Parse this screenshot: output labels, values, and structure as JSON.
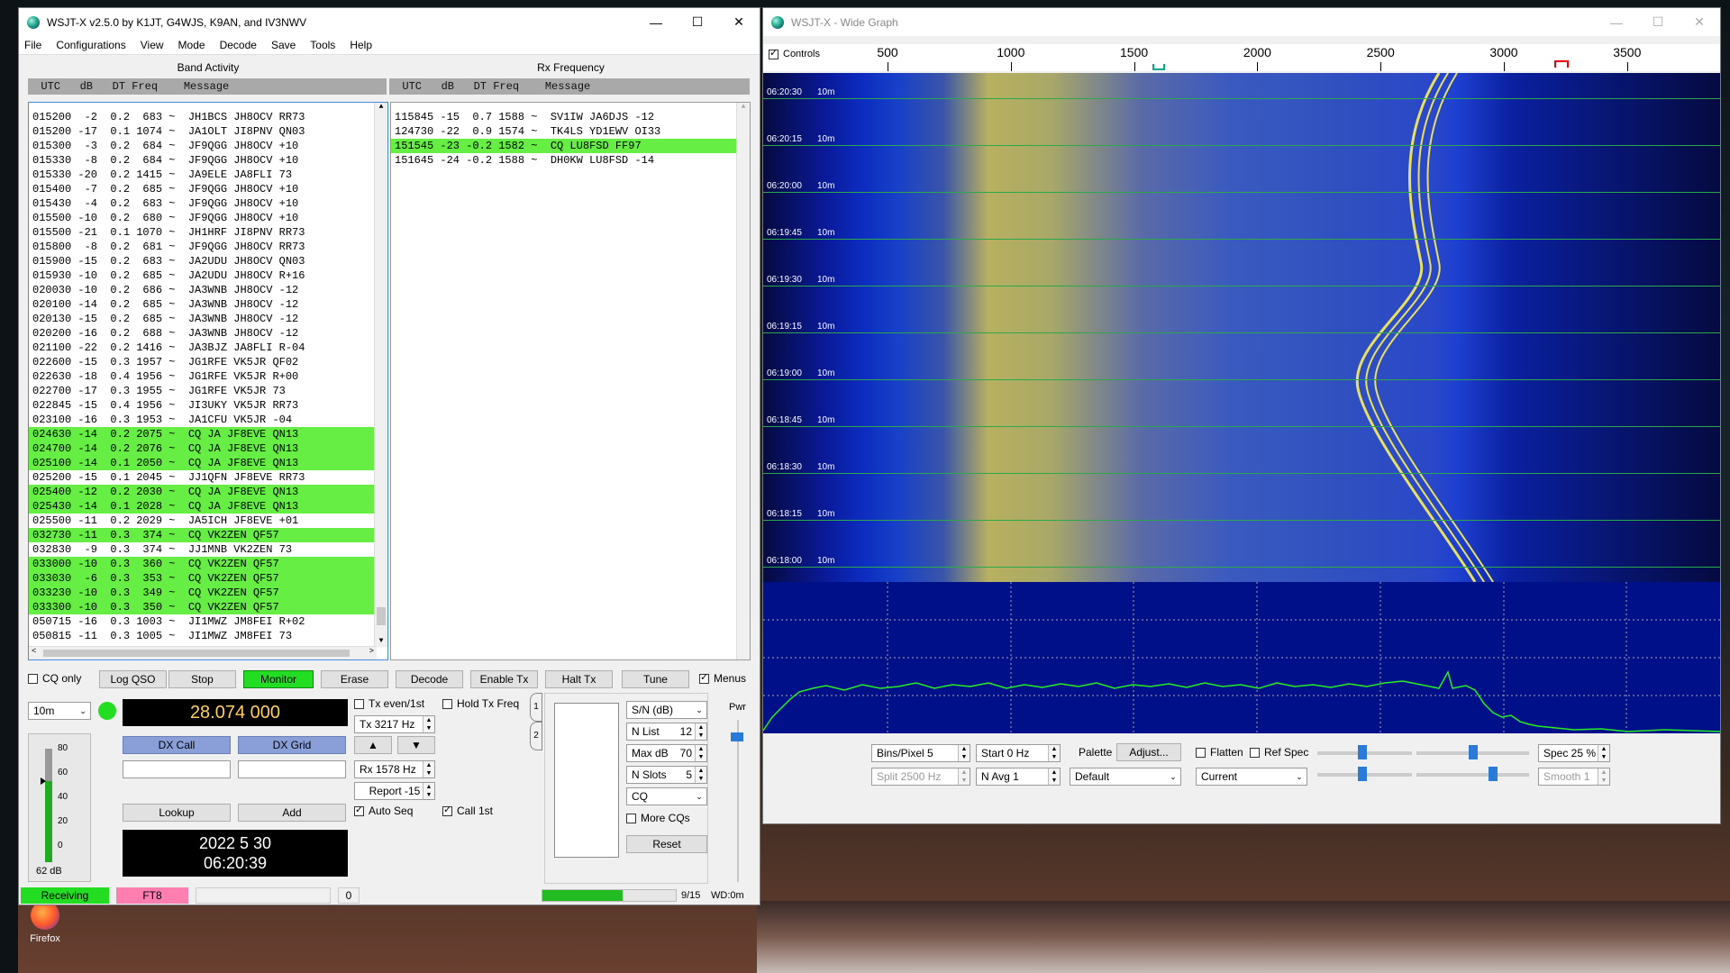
{
  "desktop": {
    "firefox_label": "Firefox"
  },
  "main": {
    "title": "WSJT-X   v2.5.0   by K1JT, G4WJS, K9AN, and IV3NWV",
    "menu": [
      "File",
      "Configurations",
      "View",
      "Mode",
      "Decode",
      "Save",
      "Tools",
      "Help"
    ],
    "band_activity_title": "Band Activity",
    "rx_frequency_title": "Rx Frequency",
    "col_header": "  UTC   dB   DT Freq    Message",
    "band_activity": [
      {
        "t": "015200  -2  0.2  683 ~  JH1BCS JH8OCV RR73",
        "hl": false
      },
      {
        "t": "015200 -17  0.1 1074 ~  JA1OLT JI8PNV QN03",
        "hl": false
      },
      {
        "t": "015300  -3  0.2  684 ~  JF9QGG JH8OCV +10",
        "hl": false
      },
      {
        "t": "015330  -8  0.2  684 ~  JF9QGG JH8OCV +10",
        "hl": false
      },
      {
        "t": "015330 -20  0.2 1415 ~  JA9ELE JA8FLI 73",
        "hl": false
      },
      {
        "t": "015400  -7  0.2  685 ~  JF9QGG JH8OCV +10",
        "hl": false
      },
      {
        "t": "015430  -4  0.2  683 ~  JF9QGG JH8OCV +10",
        "hl": false
      },
      {
        "t": "015500 -10  0.2  680 ~  JF9QGG JH8OCV +10",
        "hl": false
      },
      {
        "t": "015500 -21  0.1 1070 ~  JH1HRF JI8PNV RR73",
        "hl": false
      },
      {
        "t": "015800  -8  0.2  681 ~  JF9QGG JH8OCV RR73",
        "hl": false
      },
      {
        "t": "015900 -15  0.2  683 ~  JA2UDU JH8OCV QN03",
        "hl": false
      },
      {
        "t": "015930 -10  0.2  685 ~  JA2UDU JH8OCV R+16",
        "hl": false
      },
      {
        "t": "020030 -10  0.2  686 ~  JA3WNB JH8OCV -12",
        "hl": false
      },
      {
        "t": "020100 -14  0.2  685 ~  JA3WNB JH8OCV -12",
        "hl": false
      },
      {
        "t": "020130 -15  0.2  685 ~  JA3WNB JH8OCV -12",
        "hl": false
      },
      {
        "t": "020200 -16  0.2  688 ~  JA3WNB JH8OCV -12",
        "hl": false
      },
      {
        "t": "021100 -22  0.2 1416 ~  JA3BJZ JA8FLI R-04",
        "hl": false
      },
      {
        "t": "022600 -15  0.3 1957 ~  JG1RFE VK5JR QF02",
        "hl": false
      },
      {
        "t": "022630 -18  0.4 1956 ~  JG1RFE VK5JR R+00",
        "hl": false
      },
      {
        "t": "022700 -17  0.3 1955 ~  JG1RFE VK5JR 73",
        "hl": false
      },
      {
        "t": "022845 -15  0.4 1956 ~  JI3UKY VK5JR RR73",
        "hl": false
      },
      {
        "t": "023100 -16  0.3 1953 ~  JA1CFU VK5JR -04",
        "hl": false
      },
      {
        "t": "024630 -14  0.2 2075 ~  CQ JA JF8EVE QN13",
        "hl": true
      },
      {
        "t": "024700 -14  0.2 2076 ~  CQ JA JF8EVE QN13",
        "hl": true
      },
      {
        "t": "025100 -14  0.1 2050 ~  CQ JA JF8EVE QN13",
        "hl": true
      },
      {
        "t": "025200 -15  0.1 2045 ~  JJ1QFN JF8EVE RR73",
        "hl": false
      },
      {
        "t": "025400 -12  0.2 2030 ~  CQ JA JF8EVE QN13",
        "hl": true
      },
      {
        "t": "025430 -14  0.1 2028 ~  CQ JA JF8EVE QN13",
        "hl": true
      },
      {
        "t": "025500 -11  0.2 2029 ~  JA5ICH JF8EVE +01",
        "hl": false
      },
      {
        "t": "032730 -11  0.3  374 ~  CQ VK2ZEN QF57",
        "hl": true
      },
      {
        "t": "032830  -9  0.3  374 ~  JJ1MNB VK2ZEN 73",
        "hl": false
      },
      {
        "t": "033000 -10  0.3  360 ~  CQ VK2ZEN QF57",
        "hl": true
      },
      {
        "t": "033030  -6  0.3  353 ~  CQ VK2ZEN QF57",
        "hl": true
      },
      {
        "t": "033230 -10  0.3  349 ~  CQ VK2ZEN QF57",
        "hl": true
      },
      {
        "t": "033300 -10  0.3  350 ~  CQ VK2ZEN QF57",
        "hl": true
      },
      {
        "t": "050715 -16  0.3 1003 ~  JI1MWZ JM8FEI R+02",
        "hl": false
      },
      {
        "t": "050815 -11  0.3 1005 ~  JI1MWZ JM8FEI 73",
        "hl": false
      }
    ],
    "rx_frequency": [
      {
        "t": "115845 -15  0.7 1588 ~  SV1IW JA6DJS -12",
        "hl": false
      },
      {
        "t": "124730 -22  0.9 1574 ~  TK4LS YD1EWV OI33",
        "hl": false
      },
      {
        "t": "151545 -23 -0.2 1582 ~  CQ LU8FSD FF97",
        "hl": true
      },
      {
        "t": "151645 -24 -0.2 1588 ~  DH0KW LU8FSD -14",
        "hl": false
      }
    ],
    "buttons": {
      "cq_only": "CQ only",
      "log_qso": "Log QSO",
      "stop": "Stop",
      "monitor": "Monitor",
      "erase": "Erase",
      "decode": "Decode",
      "enable_tx": "Enable Tx",
      "halt_tx": "Halt Tx",
      "tune": "Tune",
      "menus": "Menus",
      "dx_call": "DX Call",
      "dx_grid": "DX Grid",
      "lookup": "Lookup",
      "add": "Add",
      "reset": "Reset"
    },
    "band": "10m",
    "frequency": "28.074 000",
    "tx_even": "Tx even/1st",
    "hold_tx": "Hold Tx Freq",
    "tx_freq": "Tx  3217  Hz",
    "rx_freq": "Rx  1578  Hz",
    "report": "Report  -15",
    "auto_seq": "Auto Seq",
    "call_1st": "Call 1st",
    "date": "2022 5 30",
    "time": "06:20:39",
    "meter_ticks": [
      "80",
      "60",
      "40",
      "20",
      "0"
    ],
    "meter_value": "62 dB",
    "sn_select": "S/N (dB)",
    "n_list": "N List",
    "n_list_val": "12",
    "max_db": "Max dB",
    "max_db_val": "70",
    "n_slots": "N Slots",
    "n_slots_val": "5",
    "cq_select": "CQ",
    "more_cqs": "More CQs",
    "pwr": "Pwr",
    "tab1": "1",
    "tab2": "2",
    "status_receiving": "Receiving",
    "status_mode": "FT8",
    "status_zero": "0",
    "status_progress": 0.6,
    "status_count": "9/15",
    "status_wd": "WD:0m"
  },
  "wide": {
    "title": "WSJT-X - Wide Graph",
    "controls": "Controls",
    "freq_ticks": [
      "500",
      "1000",
      "1500",
      "2000",
      "2500",
      "3000",
      "3500"
    ],
    "time_labels": [
      "06:20:30",
      "06:20:15",
      "06:20:00",
      "06:19:45",
      "06:19:30",
      "06:19:15",
      "06:19:00",
      "06:18:45",
      "06:18:30",
      "06:18:15",
      "06:18:00"
    ],
    "band_label": "10m",
    "bins_pixel": "Bins/Pixel  5",
    "start": "Start 0 Hz",
    "palette": "Palette",
    "adjust": "Adjust...",
    "flatten": "Flatten",
    "ref_spec": "Ref Spec",
    "spec": "Spec 25 %",
    "split": "Split   2500  Hz",
    "n_avg": "N Avg  1",
    "palette_sel": "Default",
    "current_sel": "Current",
    "smooth": "Smooth   1",
    "colors": {
      "accent": "#66ee44",
      "waterfall_bg": "#0a1a8a",
      "yellow": "#c8c060"
    }
  }
}
